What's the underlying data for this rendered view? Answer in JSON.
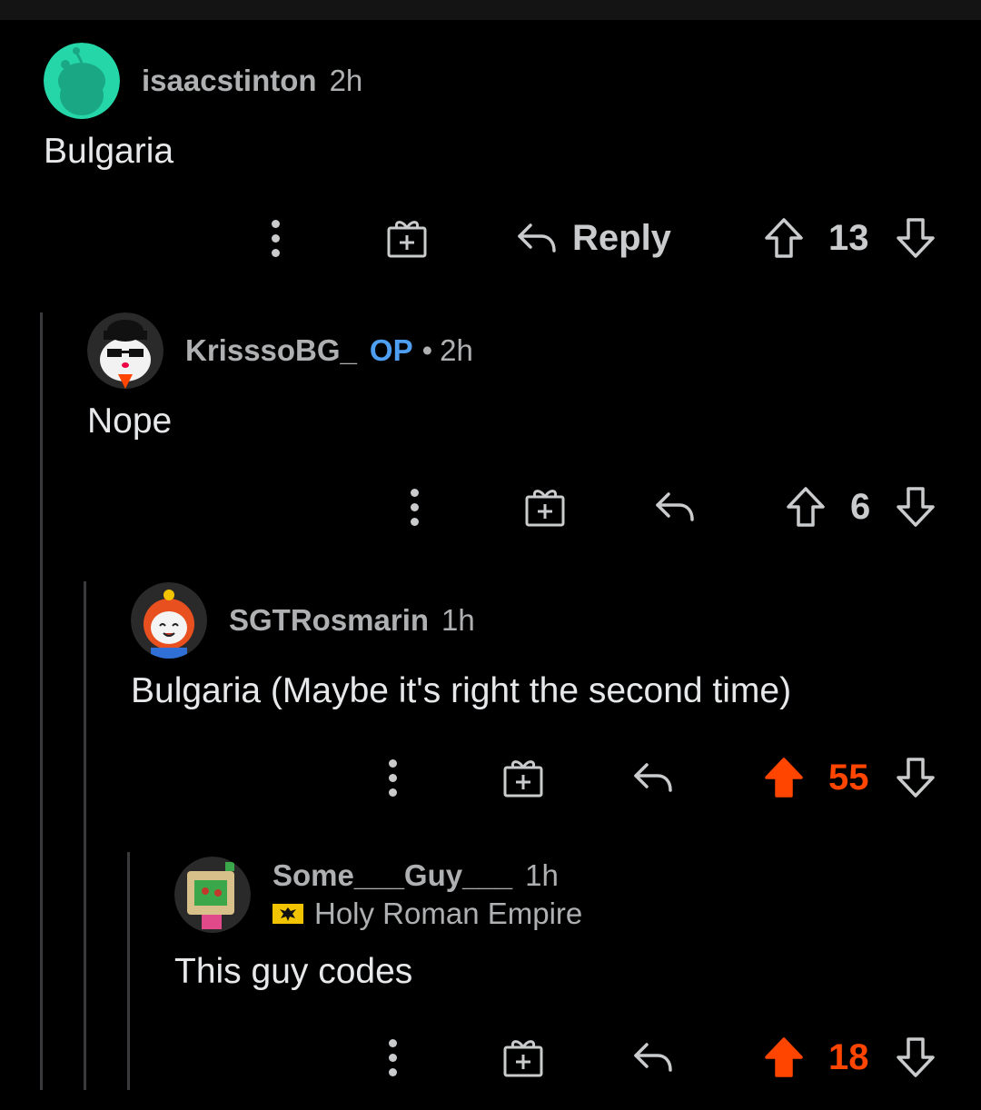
{
  "comments": [
    {
      "username": "isaacstinton",
      "op": "",
      "time": "2h",
      "flair": "",
      "body": "Bulgaria",
      "reply_label": "Reply",
      "score": "13",
      "upvoted": false
    },
    {
      "username": "KrisssoBG_",
      "op": "OP",
      "time": "2h",
      "flair": "",
      "body": "Nope",
      "reply_label": "",
      "score": "6",
      "upvoted": false
    },
    {
      "username": "SGTRosmarin",
      "op": "",
      "time": "1h",
      "flair": "",
      "body": "Bulgaria (Maybe it's right the second time)",
      "reply_label": "",
      "score": "55",
      "upvoted": true
    },
    {
      "username": "Some___Guy___",
      "op": "",
      "time": "1h",
      "flair": "Holy Roman Empire",
      "body": "This guy codes",
      "reply_label": "",
      "score": "18",
      "upvoted": true
    }
  ],
  "colors": {
    "background": "#000000",
    "upvote_active": "#ff4500",
    "op_badge": "#4e9ef2",
    "muted_text": "#aeb0b2",
    "thread_line": "#3a3a3c"
  },
  "icons": [
    "more-options-icon",
    "award-gift-icon",
    "reply-arrow-icon",
    "upvote-arrow-icon",
    "downvote-arrow-icon",
    "flair-eagle-icon"
  ]
}
